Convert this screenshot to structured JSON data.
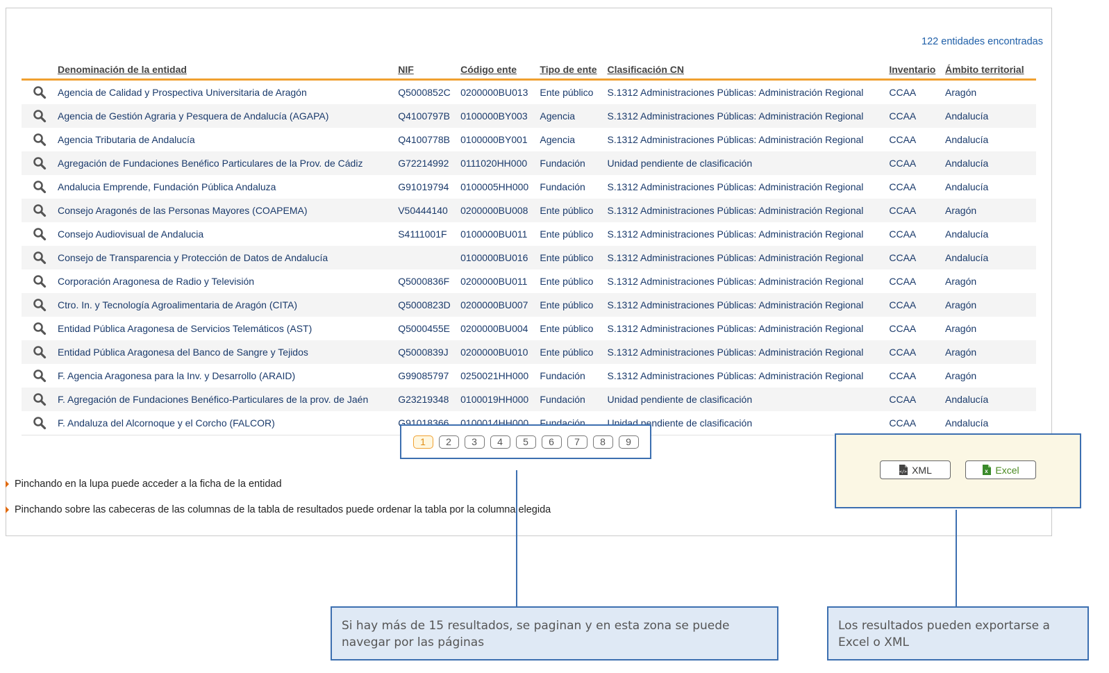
{
  "results": {
    "count_text": "122 entidades encontradas",
    "columns": [
      "Denominación de la entidad",
      "NIF",
      "Código ente",
      "Tipo de ente",
      "Clasificación CN",
      "Inventario",
      "Ámbito territorial"
    ],
    "rows": [
      [
        "Agencia de Calidad y Prospectiva Universitaria de Aragón",
        "Q5000852C",
        "0200000BU013",
        "Ente público",
        "S.1312 Administraciones Públicas: Administración Regional",
        "CCAA",
        "Aragón"
      ],
      [
        "Agencia de Gestión Agraria y Pesquera de Andalucía (AGAPA)",
        "Q4100797B",
        "0100000BY003",
        "Agencia",
        "S.1312 Administraciones Públicas: Administración Regional",
        "CCAA",
        "Andalucía"
      ],
      [
        "Agencia Tributaria de Andalucía",
        "Q4100778B",
        "0100000BY001",
        "Agencia",
        "S.1312 Administraciones Públicas: Administración Regional",
        "CCAA",
        "Andalucía"
      ],
      [
        "Agregación de Fundaciones Benéfico Particulares de la Prov. de Cádiz",
        "G72214992",
        "0111020HH000",
        "Fundación",
        "Unidad pendiente de clasificación",
        "CCAA",
        "Andalucía"
      ],
      [
        "Andalucia Emprende, Fundación Pública Andaluza",
        "G91019794",
        "0100005HH000",
        "Fundación",
        "S.1312 Administraciones Públicas: Administración Regional",
        "CCAA",
        "Andalucía"
      ],
      [
        "Consejo Aragonés de las Personas Mayores (COAPEMA)",
        "V50444140",
        "0200000BU008",
        "Ente público",
        "S.1312 Administraciones Públicas: Administración Regional",
        "CCAA",
        "Aragón"
      ],
      [
        "Consejo Audiovisual de Andalucia",
        "S4111001F",
        "0100000BU011",
        "Ente público",
        "S.1312 Administraciones Públicas: Administración Regional",
        "CCAA",
        "Andalucía"
      ],
      [
        "Consejo de Transparencia y Protección de Datos de Andalucía",
        "",
        "0100000BU016",
        "Ente público",
        "S.1312 Administraciones Públicas: Administración Regional",
        "CCAA",
        "Andalucía"
      ],
      [
        "Corporación Aragonesa de Radio y Televisión",
        "Q5000836F",
        "0200000BU011",
        "Ente público",
        "S.1312 Administraciones Públicas: Administración Regional",
        "CCAA",
        "Aragón"
      ],
      [
        "Ctro. In. y Tecnología Agroalimentaria de Aragón (CITA)",
        "Q5000823D",
        "0200000BU007",
        "Ente público",
        "S.1312 Administraciones Públicas: Administración Regional",
        "CCAA",
        "Aragón"
      ],
      [
        "Entidad Pública Aragonesa de Servicios Telemáticos (AST)",
        "Q5000455E",
        "0200000BU004",
        "Ente público",
        "S.1312 Administraciones Públicas: Administración Regional",
        "CCAA",
        "Aragón"
      ],
      [
        "Entidad Pública Aragonesa del Banco de Sangre y Tejidos",
        "Q5000839J",
        "0200000BU010",
        "Ente público",
        "S.1312 Administraciones Públicas: Administración Regional",
        "CCAA",
        "Aragón"
      ],
      [
        "F. Agencia Aragonesa para la Inv. y Desarrollo (ARAID)",
        "G99085797",
        "0250021HH000",
        "Fundación",
        "S.1312 Administraciones Públicas: Administración Regional",
        "CCAA",
        "Aragón"
      ],
      [
        "F. Agregación de Fundaciones Benéfico-Particulares de la prov. de Jaén",
        "G23219348",
        "0100019HH000",
        "Fundación",
        "Unidad pendiente de clasificación",
        "CCAA",
        "Andalucía"
      ],
      [
        "F. Andaluza del Alcornoque y el Corcho (FALCOR)",
        "G91018366",
        "0100014HH000",
        "Fundación",
        "Unidad pendiente de clasificación",
        "CCAA",
        "Andalucía"
      ]
    ]
  },
  "pagination": {
    "pages": [
      "1",
      "2",
      "3",
      "4",
      "5",
      "6",
      "7",
      "8",
      "9"
    ],
    "current": "1"
  },
  "hints": [
    "Pinchando en la lupa puede acceder a la ficha de la entidad",
    "Pinchando sobre las cabeceras de las columnas de la tabla de resultados puede ordenar la tabla por la columna elegida"
  ],
  "export": {
    "xml_label": "XML",
    "excel_label": "Excel"
  },
  "callouts": {
    "pagination_note": "Si hay más de 15 resultados, se paginan y en esta zona se puede navegar por las páginas",
    "export_note": "Los resultados pueden exportarse a Excel o XML"
  },
  "colors": {
    "header_rule": "#f0a030",
    "link_text": "#1a3a6b",
    "callout_border": "#3c6fb0",
    "callout_bg": "#dfe9f5"
  }
}
